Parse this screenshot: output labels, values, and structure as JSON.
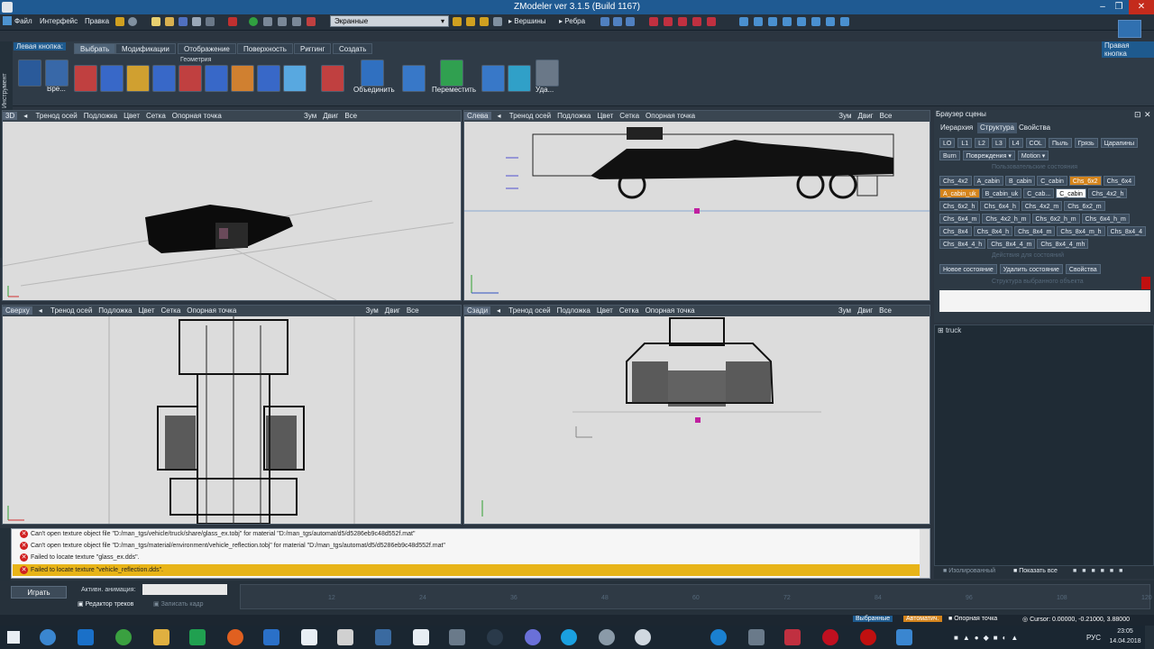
{
  "window": {
    "title": "ZModeler ver 3.1.5 (Build 1167)"
  },
  "menu": {
    "file": "Файл",
    "interface": "Интерфейс",
    "edit": "Правка"
  },
  "toolbar": {
    "display_mode": "Экранные",
    "vertices": "Вершины",
    "edges": "Ребра"
  },
  "ribbon": {
    "left_button": "Левая кнопка:",
    "right_button": "Правая кнопка",
    "tabs": [
      "Выбрать",
      "Модификации",
      "Отображение",
      "Поверхность",
      "Риггинг",
      "Создать"
    ],
    "group": "Геометрия",
    "tools_label": "Инструмент",
    "btn_rotate": "Вре...",
    "btn_combine": "Объединить",
    "btn_move": "Переместить",
    "btn_delete": "Уда..."
  },
  "viewport_menu": [
    "Тренод осей",
    "Подложка",
    "Цвет",
    "Сетка",
    "Опорная точка"
  ],
  "viewport_right": [
    "Зум",
    "Двиг",
    "Все"
  ],
  "viewports": {
    "tl": "3D",
    "tr": "Слева",
    "bl": "Сверху",
    "br": "Сзади"
  },
  "scene": {
    "title": "Браузер сцены",
    "tabs": [
      "Иерархия",
      "Структура",
      "Свойства"
    ],
    "row1": [
      "LO",
      "L1",
      "L2",
      "L3",
      "L4",
      "COL",
      "Пыль",
      "Грязь",
      "Царапины"
    ],
    "burn": "Burn",
    "damage": "Повреждения",
    "motion": "Motion",
    "grid": [
      [
        "Chs_4x2",
        "A_cabin",
        "B_cabin",
        "C_cabin",
        "Chs_6x2",
        "Chs_6x4"
      ],
      [
        "A_cabin_uk",
        "B_cabin_uk",
        "C_cab...",
        "C_cabin",
        "Chs_4x2_h"
      ],
      [
        "Chs_6x2_h",
        "Chs_6x4_h",
        "Chs_4x2_m",
        "Chs_6x2_m"
      ],
      [
        "Chs_6x4_m",
        "Chs_4x2_h_m",
        "Chs_6x2_h_m",
        "Chs_6x4_h_m"
      ],
      [
        "Chs_8x4",
        "Chs_8x4_h",
        "Chs_8x4_m",
        "Chs_8x4_m_h",
        "Chs_8x4_4"
      ],
      [
        "Chs_8x4_4_h",
        "Chs_8x4_4_m",
        "Chs_8x4_4_mh"
      ]
    ],
    "new_state": "Новое состояние",
    "delete_state": "Удалить состояние",
    "props": "Свойства",
    "faded1": "Пользовательские состояния",
    "faded2": "Действия для состояний",
    "faded3": "Структура выбранного объекта",
    "tree_item": "truck",
    "isolated": "Изолированный",
    "show_all": "Показать все"
  },
  "log": [
    "Can't open texture object file \"D:/man_tgs/vehicle/truck/share/glass_ex.tobj\" for material \"D:/man_tgs/automat/d5/d5286eb9c48d552f.mat\"",
    "Can't open texture object file \"D:/man_tgs/material/environment/vehicle_reflection.tobj\" for material \"D:/man_tgs/automat/d5/d5286eb9c48d552f.mat\"",
    "Failed to locate texture \"glass_ex.dds\".",
    "Failed to locate texture \"vehicle_reflection.dds\"."
  ],
  "timeline": {
    "play": "Играть",
    "anim_label": "Активн. анимация:",
    "track_editor": "Редактор треков",
    "record": "Записать кадр",
    "ticks": [
      "12",
      "24",
      "36",
      "48",
      "60",
      "72",
      "84",
      "96",
      "108",
      "120"
    ]
  },
  "status": {
    "selected": "Выбранные",
    "auto": "Автоматич.",
    "pivot": "Опорная точка",
    "cursor": "Cursor: 0.00000, -0.21000, 3.88000"
  },
  "taskbar": {
    "lang": "РУС",
    "time": "23:05",
    "date": "14.04.2018"
  },
  "colors": {
    "accent": "#d4841c",
    "title": "#1f5a92",
    "viewport": "#dcdcdc"
  }
}
